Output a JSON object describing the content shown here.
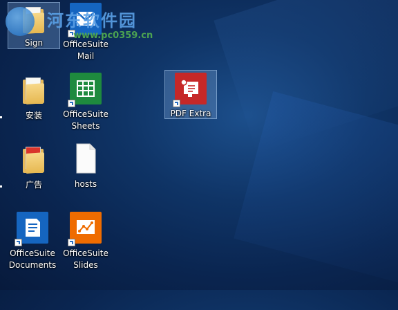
{
  "desktop": {
    "icons": [
      {
        "id": "sign",
        "label": "Sign"
      },
      {
        "id": "officesuite-mail",
        "label": "OfficeSuite\nMail"
      },
      {
        "id": "anzhuang",
        "label": "安装"
      },
      {
        "id": "officesuite-sheets",
        "label": "OfficeSuite\nSheets"
      },
      {
        "id": "pdf-extra",
        "label": "PDF Extra"
      },
      {
        "id": "guanggao",
        "label": "广告"
      },
      {
        "id": "hosts",
        "label": "hosts"
      },
      {
        "id": "officesuite-documents",
        "label": "OfficeSuite\nDocuments"
      },
      {
        "id": "officesuite-slides",
        "label": "OfficeSuite\nSlides"
      }
    ]
  },
  "watermark": {
    "title": "河东软件园",
    "url": "www.pc0359.cn"
  },
  "colors": {
    "mail": "#1565c0",
    "sheets": "#1e8a3e",
    "pdf": "#c62828",
    "documents": "#1565c0",
    "slides": "#ef6c00"
  }
}
